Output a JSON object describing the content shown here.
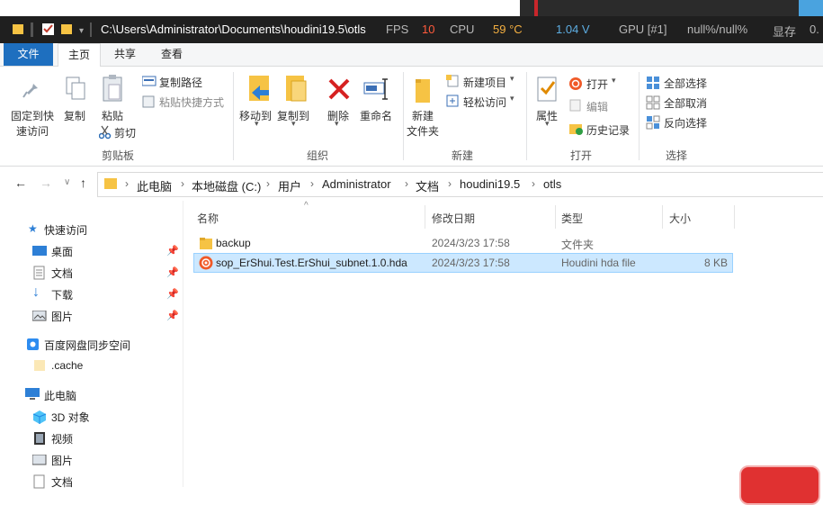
{
  "titlebar": {
    "path": "C:\\Users\\Administrator\\Documents\\houdini19.5\\otls",
    "overlay": {
      "fps_label": "FPS",
      "fps_value": "10",
      "cpu_label": "CPU",
      "cpu_temp": "59 °C",
      "voltage": "1.04 V",
      "gpu_label": "GPU [#1]",
      "gpu_value": "null%/null%",
      "display_label": "显存",
      "display_value": "0."
    }
  },
  "tabs": {
    "file": "文件",
    "home": "主页",
    "share": "共享",
    "view": "查看"
  },
  "ribbon": {
    "clipboard": {
      "pin_quick_line1": "固定到快",
      "pin_quick_line2": "速访问",
      "copy": "复制",
      "paste": "粘贴",
      "copy_path": "复制路径",
      "paste_shortcut": "粘贴快捷方式",
      "cut": "剪切",
      "group": "剪贴板"
    },
    "organize": {
      "move_to": "移动到",
      "copy_to": "复制到",
      "delete": "删除",
      "rename": "重命名",
      "group": "组织"
    },
    "new": {
      "new_folder_line1": "新建",
      "new_folder_line2": "文件夹",
      "new_item": "新建项目",
      "easy_access": "轻松访问",
      "group": "新建"
    },
    "open": {
      "properties": "属性",
      "open": "打开",
      "edit": "编辑",
      "history": "历史记录",
      "group": "打开"
    },
    "select": {
      "select_all": "全部选择",
      "select_none": "全部取消",
      "invert": "反向选择",
      "group": "选择"
    }
  },
  "breadcrumbs": [
    "此电脑",
    "本地磁盘 (C:)",
    "用户",
    "Administrator",
    "文档",
    "houdini19.5",
    "otls"
  ],
  "sidebar": {
    "quick_access": "快速访问",
    "pinned": [
      "桌面",
      "文档",
      "下载",
      "图片"
    ],
    "baidu": "百度网盘同步空间",
    "cache": ".cache",
    "this_pc": "此电脑",
    "pc_items": [
      "3D 对象",
      "视频",
      "图片",
      "文档"
    ]
  },
  "columns": {
    "name": "名称",
    "date": "修改日期",
    "type": "类型",
    "size": "大小"
  },
  "files": [
    {
      "name": "backup",
      "date": "2024/3/23 17:58",
      "type": "文件夹",
      "size": ""
    },
    {
      "name": "sop_ErShui.Test.ErShui_subnet.1.0.hda",
      "date": "2024/3/23 17:58",
      "type": "Houdini hda file",
      "size": "8 KB"
    }
  ],
  "colors": {
    "accent": "#1e6fbf",
    "selection": "#cce8ff",
    "folder": "#f6c344",
    "houdini": "#f05a28"
  }
}
